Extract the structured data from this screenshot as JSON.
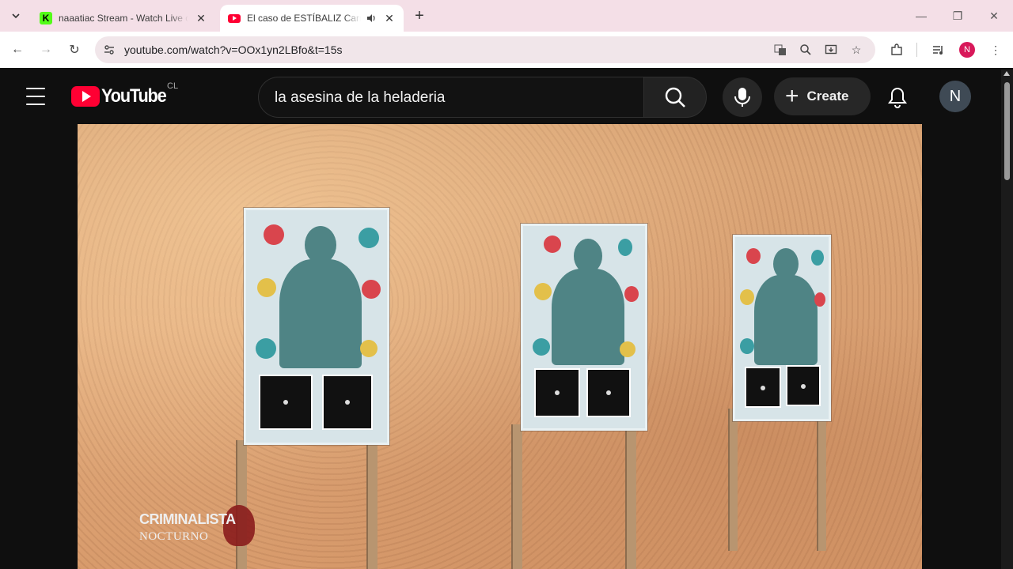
{
  "browser": {
    "tabs": [
      {
        "title": "naaatiac Stream - Watch Live on Kick",
        "favicon": "kick-icon",
        "active": false
      },
      {
        "title": "El caso de ESTÍBALIZ Carranza",
        "favicon": "youtube-icon",
        "active": true,
        "audio": true
      }
    ],
    "address": {
      "url": "youtube.com/watch?v=OOx1yn2LBfo&t=15s"
    },
    "profile_initial": "N",
    "accent_color": "#f4dfe7"
  },
  "youtube": {
    "logo_text": "YouTube",
    "country_code": "CL",
    "search_query": "la asesina de la heladeria",
    "create_label": "Create",
    "avatar_initial": "N"
  },
  "video": {
    "watermark_line1": "CRIMINALISTA",
    "watermark_line2": "NOCTURNO"
  }
}
